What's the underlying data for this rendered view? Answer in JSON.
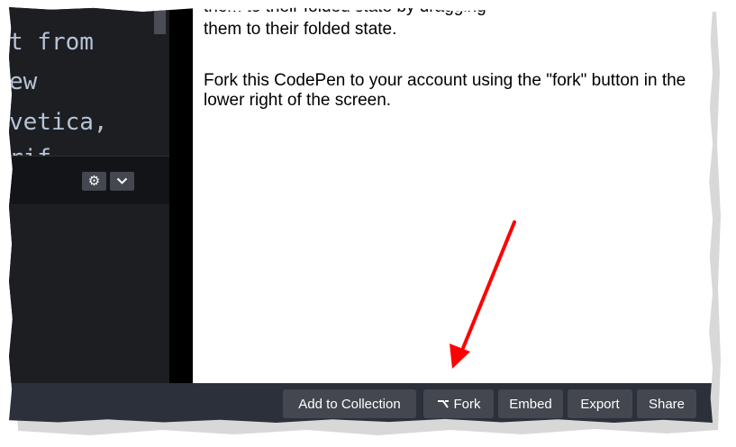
{
  "editor": {
    "code_lines": [
      "t from",
      "ew",
      "vetica,",
      "rif"
    ],
    "icons": {
      "settings": "gear-icon",
      "collapse": "chevron-down-icon"
    }
  },
  "preview": {
    "cut_text": "them to their folded state by dragging",
    "paragraph_1": "them to their folded state.",
    "paragraph_2": "Fork this CodePen to your account using the \"fork\" button in the lower right of the screen."
  },
  "footer": {
    "add_to_collection": "Add to Collection",
    "fork": "Fork",
    "embed": "Embed",
    "export": "Export",
    "share": "Share",
    "fork_icon": "fork-icon"
  },
  "annotation": {
    "arrow_color": "#ff0000",
    "arrow_icon": "arrow-annotation"
  }
}
